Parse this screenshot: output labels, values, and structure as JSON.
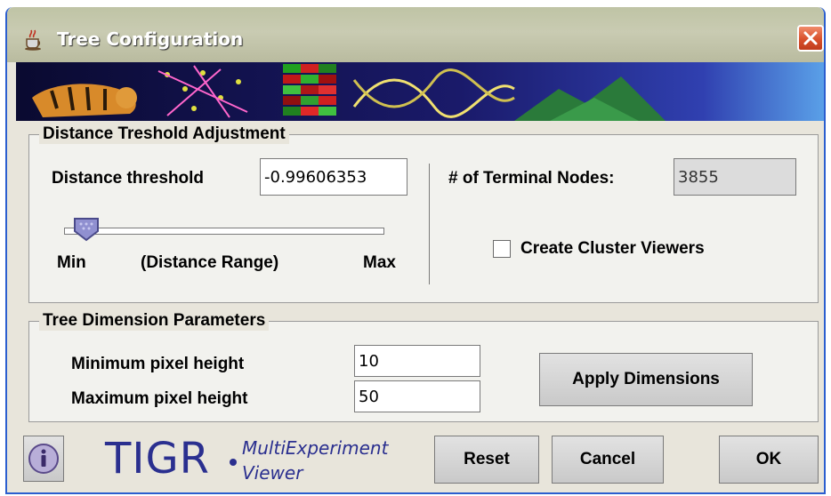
{
  "window": {
    "title": "Tree Configuration",
    "icon": "java-cup-icon",
    "close_icon": "close-icon"
  },
  "distance_group": {
    "title": "Distance Treshold Adjustment",
    "threshold_label": "Distance threshold",
    "threshold_value": "-0.99606353",
    "slider_level": 0.05,
    "slider_min_label": "Min",
    "slider_range_label": "(Distance Range)",
    "slider_max_label": "Max",
    "terminal_nodes_label": "# of Terminal Nodes:",
    "terminal_nodes_value": "3855",
    "cluster_viewers_label": "Create Cluster Viewers",
    "cluster_viewers_checked": false
  },
  "dimension_group": {
    "title": "Tree Dimension Parameters",
    "min_height_label": "Minimum pixel height",
    "min_height_value": "10",
    "max_height_label": "Maximum pixel height",
    "max_height_value": "50",
    "apply_label": "Apply Dimensions"
  },
  "footer": {
    "info_icon": "info-icon",
    "brand_tigr": "TIGR",
    "brand_line1": "MultiExperiment",
    "brand_line2": "Viewer",
    "reset_label": "Reset",
    "cancel_label": "Cancel",
    "ok_label": "OK"
  },
  "colors": {
    "title_bar": "#c4c6a8",
    "close_button": "#d8502c",
    "frame_border": "#2b5ecf",
    "brand_blue": "#2a2f8f",
    "slider_thumb": "#9090d0"
  }
}
